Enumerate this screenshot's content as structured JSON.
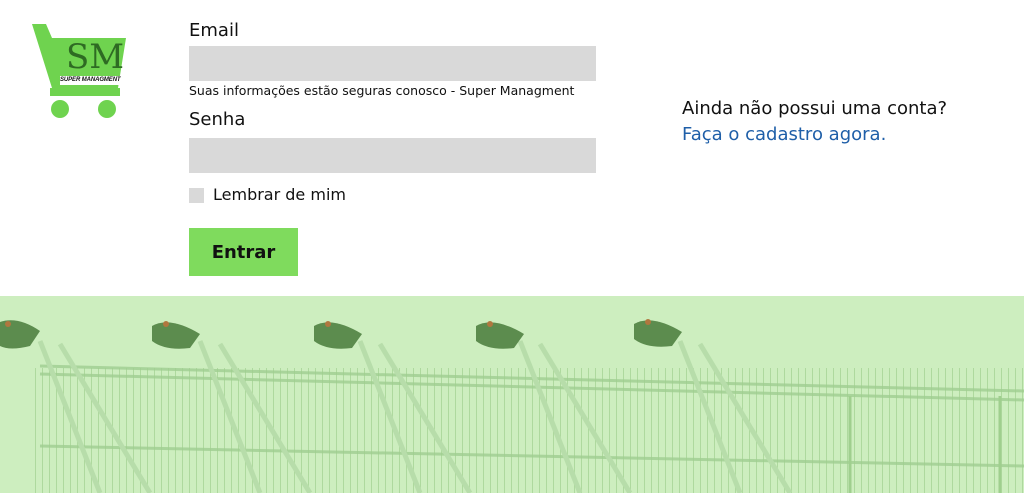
{
  "logo": {
    "monogram": "SM",
    "brand_text": "SUPER MANAGMENT",
    "icon": "shopping-cart-icon",
    "color": "#6fd34f"
  },
  "form": {
    "email_label": "Email",
    "email_value": "",
    "email_placeholder": "",
    "email_hint": "Suas informações estão seguras conosco - Super Managment",
    "password_label": "Senha",
    "password_value": "",
    "password_placeholder": "",
    "remember_label": "Lembrar de mim",
    "remember_checked": false,
    "submit_label": "Entrar"
  },
  "signup": {
    "question": "Ainda não possui uma conta?",
    "link_text": "Faça o cadastro agora."
  },
  "banner": {
    "image": "shopping-carts-photo",
    "overlay_color": "#cdeebf"
  },
  "colors": {
    "accent": "#7fdb5d",
    "link": "#1f5fa8",
    "field_bg": "#d9d9d9"
  }
}
